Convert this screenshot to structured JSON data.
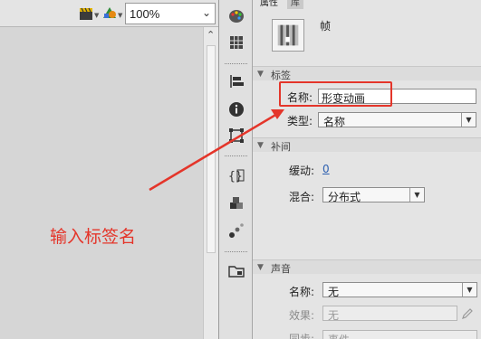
{
  "toolbar": {
    "zoom_value": "100%"
  },
  "panel": {
    "tabs": [
      {
        "label": "属性"
      },
      {
        "label": "库"
      }
    ],
    "frame_title": "帧",
    "label_section": {
      "title": "标签",
      "name_label": "名称:",
      "name_value": "形变动画",
      "type_label": "类型:",
      "type_value": "名称"
    },
    "tween_section": {
      "title": "补间",
      "ease_label": "缓动:",
      "ease_value": "0",
      "blend_label": "混合:",
      "blend_value": "分布式"
    },
    "sound_section": {
      "title": "声音",
      "name_label": "名称:",
      "name_value": "无",
      "effect_label": "效果:",
      "effect_value": "无",
      "sync_label": "同步:",
      "sync_value": "事件"
    }
  },
  "annotation": {
    "text": "输入标签名",
    "color": "#e4352a"
  }
}
